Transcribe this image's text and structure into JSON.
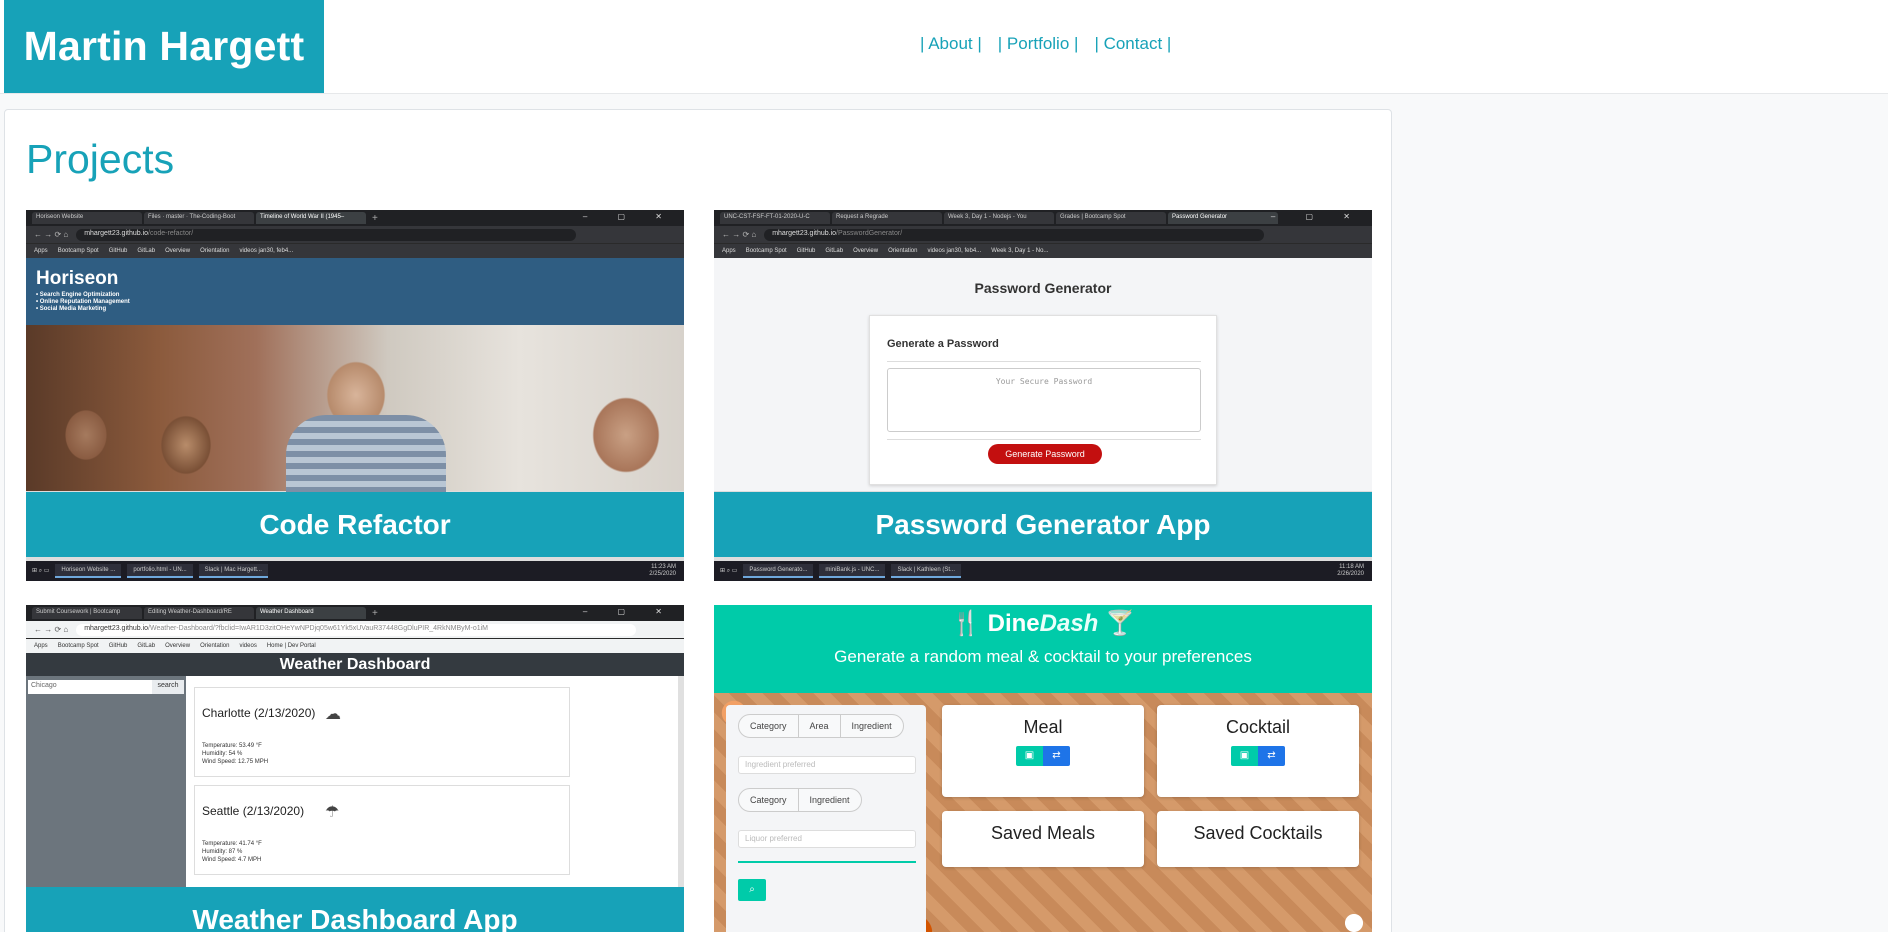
{
  "header": {
    "brand": "Martin Hargett",
    "nav": [
      {
        "label": "| About |"
      },
      {
        "label": "| Portfolio |"
      },
      {
        "label": "| Contact |"
      }
    ]
  },
  "main": {
    "title": "Projects",
    "projects": [
      {
        "title": "Code Refactor",
        "screenshot": {
          "tabs": [
            "Horiseon Website",
            "Files · master · The-Coding-Boot",
            "Timeline of World War II (1945–"
          ],
          "url_host": "mhargett23.github.io",
          "url_path": "/code-refactor/",
          "bookmarks": [
            "Apps",
            "Bootcamp Spot",
            "GitHub",
            "GitLab",
            "Overview",
            "Orientation",
            "videos jan30, feb4..."
          ],
          "site_name": "Horiseon",
          "site_list": [
            "• Search Engine Optimization",
            "• Online Reputation Management",
            "• Social Media Marketing"
          ],
          "taskbar": [
            "Horiseon Website ...",
            "portfolio.html - UN...",
            "Slack | Mac Hargett..."
          ],
          "clock": [
            "11:23 AM",
            "2/25/2020"
          ]
        }
      },
      {
        "title": "Password Generator App",
        "screenshot": {
          "tabs": [
            "UNC-CST-FSF-FT-01-2020-U-C",
            "Request a Regrade",
            "Week 3, Day 1 - Nodejs - You",
            "Grades | Bootcamp Spot",
            "Password Generator"
          ],
          "url_host": "mhargett23.github.io",
          "url_path": "/PasswordGenerator/",
          "bookmarks": [
            "Apps",
            "Bootcamp Spot",
            "GitHub",
            "GitLab",
            "Overview",
            "Orientation",
            "videos jan30, feb4...",
            "Week 3, Day 1 - No..."
          ],
          "page_title": "Password Generator",
          "card_heading": "Generate a Password",
          "placeholder": "Your Secure Password",
          "button": "Generate Password",
          "taskbar": [
            "Password Generato...",
            "miniBank.js - UNC...",
            "Slack | Kathleen (St..."
          ],
          "clock": [
            "11:18 AM",
            "2/26/2020"
          ]
        }
      },
      {
        "title": "Weather Dashboard App",
        "screenshot": {
          "tabs": [
            "Submit Coursework | Bootcamp",
            "Editing Weather-Dashboard/RE",
            "Weather Dashboard"
          ],
          "url_host": "mhargett23.github.io",
          "url_path": "/Weather-Dashboard/?fbclid=IwAR1D3zitOHeYwNPDjq05w61Yk5xUVauR37448GgDluPIR_4RkNMByM-o1iM",
          "bookmarks": [
            "Apps",
            "Bootcamp Spot",
            "GitHub",
            "GitLab",
            "Overview",
            "Orientation",
            "videos",
            "Home | Dev Portal"
          ],
          "header": "Weather Dashboard",
          "search_value": "Chicago",
          "search_button": "search",
          "cities": [
            {
              "name": "Charlotte (2/13/2020)",
              "temp": "Temperature: 53.49 °F",
              "humidity": "Humidity: 54 %",
              "wind": "Wind Speed: 12.75 MPH"
            },
            {
              "name": "Seattle (2/13/2020)",
              "temp": "Temperature: 41.74 °F",
              "humidity": "Humidity: 87 %",
              "wind": "Wind Speed: 4.7 MPH"
            }
          ]
        }
      },
      {
        "title": "",
        "screenshot": {
          "logo_a": "Dine",
          "logo_b": "Dash",
          "tagline": "Generate a random meal & cocktail to your preferences",
          "filter1": [
            "Category",
            "Area",
            "Ingredient"
          ],
          "input1": "Ingredient preferred",
          "filter2": [
            "Category",
            "Ingredient"
          ],
          "input2": "Liquor preferred",
          "meal": "Meal",
          "cocktail": "Cocktail",
          "saved_meals": "Saved Meals",
          "saved_cocktails": "Saved Cocktails"
        }
      }
    ]
  },
  "colors": {
    "accent": "#17a2b8",
    "danger": "#c30f0f",
    "teal": "#00cba9"
  }
}
